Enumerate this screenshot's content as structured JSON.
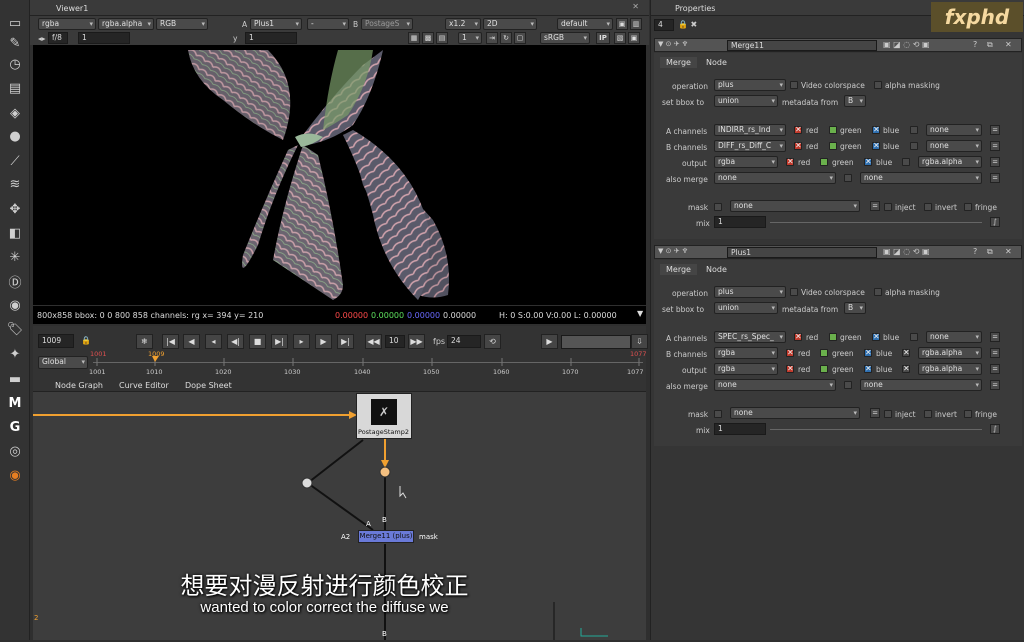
{
  "viewer": {
    "tab": "Viewer1",
    "channels": "rgba",
    "alpha": "rgba.alpha",
    "display": "RGB",
    "a_label": "A",
    "a_input": "Plus1",
    "mid": "-",
    "b_label": "B",
    "b_input": "PostageS",
    "zoom": "x1.2",
    "view": "2D",
    "lut": "default",
    "fstop": "f/8",
    "gain": "1",
    "y_label": "y",
    "gamma": "1",
    "frame_field": "1",
    "colorspace": "sRGB",
    "ip": "IP"
  },
  "status": {
    "info": "800x858 bbox: 0 0 800 858 channels: rg  x= 394 y= 210",
    "r": "0.00000",
    "g": "0.00000",
    "b": "0.00000",
    "a": "0.00000",
    "hsv": "H:  0 S:0.00 V:0.00  L: 0.00000"
  },
  "playback": {
    "frame": "1009",
    "mode": "Global",
    "step": "10",
    "fps_label": "fps",
    "fps": "24",
    "ticks": [
      "1001",
      "1010",
      "1020",
      "1030",
      "1040",
      "1050",
      "1060",
      "1070",
      "1077"
    ],
    "in_mark": "1001",
    "cur_mark": "1009",
    "out_mark": "1077"
  },
  "nodegraph": {
    "tabs": [
      "Node Graph",
      "Curve Editor",
      "Dope Sheet"
    ],
    "postage": "PostageStamp2",
    "merge": "Merge11 (plus)",
    "a_in": "A",
    "a2_in": "A2",
    "b_in": "B",
    "b_in2": "B",
    "mask_in": "mask",
    "page_num": "2"
  },
  "props": {
    "title": "Properties",
    "count": "4",
    "merge11": {
      "name": "Merge11",
      "tabs": [
        "Merge",
        "Node"
      ],
      "operation_label": "operation",
      "operation": "plus",
      "video_cs": "Video colorspace",
      "alpha_mask": "alpha masking",
      "bbox_label": "set bbox to",
      "bbox": "union",
      "meta_label": "metadata from",
      "meta": "B",
      "a_ch_label": "A channels",
      "a_ch": "INDIRR_rs_Ind",
      "b_ch_label": "B channels",
      "b_ch": "DIFF_rs_Diff_C",
      "out_label": "output",
      "out": "rgba",
      "also_label": "also merge",
      "also": "none",
      "also2": "none",
      "red": "red",
      "green": "green",
      "blue": "blue",
      "none": "none",
      "out_alpha": "rgba.alpha",
      "mask_label": "mask",
      "mask": "none",
      "inject": "inject",
      "invert": "invert",
      "fringe": "fringe",
      "mix_label": "mix",
      "mix": "1"
    },
    "plus1": {
      "name": "Plus1",
      "tabs": [
        "Merge",
        "Node"
      ],
      "operation_label": "operation",
      "operation": "plus",
      "video_cs": "Video colorspace",
      "alpha_mask": "alpha masking",
      "bbox_label": "set bbox to",
      "bbox": "union",
      "meta_label": "metadata from",
      "meta": "B",
      "a_ch_label": "A channels",
      "a_ch": "SPEC_rs_Spec_",
      "b_ch_label": "B channels",
      "b_ch": "rgba",
      "out_label": "output",
      "out": "rgba",
      "also_label": "also merge",
      "also": "none",
      "also2": "none",
      "red": "red",
      "green": "green",
      "blue": "blue",
      "none": "none",
      "b_alpha": "rgba.alpha",
      "out_alpha": "rgba.alpha",
      "mask_label": "mask",
      "mask": "none",
      "inject": "inject",
      "invert": "invert",
      "fringe": "fringe",
      "mix_label": "mix",
      "mix": "1"
    }
  },
  "subtitle": {
    "cn": "想要对漫反射进行颜色校正",
    "en": "wanted to color correct the diffuse we"
  },
  "logo": "fxphd"
}
